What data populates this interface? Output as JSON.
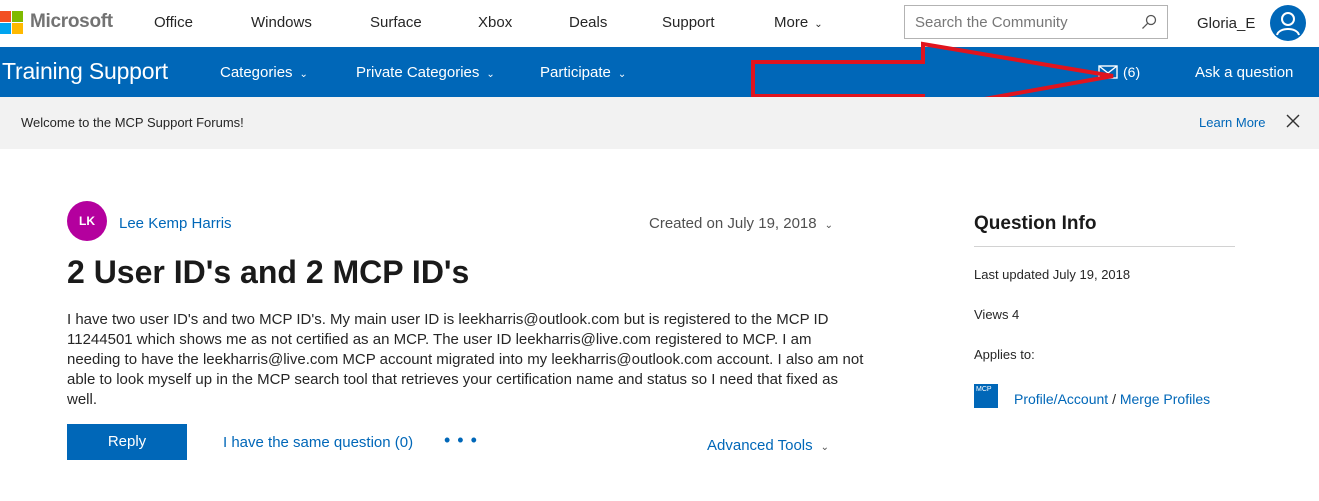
{
  "colors": {
    "brand_blue": "#0067b8",
    "banner_bg": "#f2f2f2",
    "avatar_lk": "#b4009e",
    "annotation_red": "#e0141e",
    "ms_logo": [
      "#f25022",
      "#7fba00",
      "#00a4ef",
      "#ffb900"
    ]
  },
  "topbar": {
    "logo_text": "Microsoft",
    "nav": [
      "Office",
      "Windows",
      "Surface",
      "Xbox",
      "Deals",
      "Support",
      "More"
    ],
    "search_placeholder": "Search the Community",
    "user_name": "Gloria_E"
  },
  "bluebar": {
    "brand": "Training Support",
    "nav": [
      "Categories",
      "Private Categories",
      "Participate"
    ],
    "mail_count": "(6)",
    "ask": "Ask a question"
  },
  "banner": {
    "text": "Welcome to the MCP Support Forums!",
    "learn_more": "Learn More"
  },
  "question": {
    "avatar_initials": "LK",
    "author": "Lee Kemp Harris",
    "created": "Created on July 19, 2018",
    "title": "2 User ID's and 2 MCP ID's",
    "body": "I have two user ID's and two MCP ID's. My main user ID is leekharris@outlook.com but is registered to the MCP ID 11244501 which shows me as not certified as an MCP. The user ID leekharris@live.com registered to MCP. I am needing to have the leekharris@live.com MCP account migrated into my leekharris@outlook.com account. I also am not able to look myself up in the MCP search tool that retrieves your certification name and status so I need that fixed as well.",
    "reply": "Reply",
    "same_question": "I have the same question (0)",
    "more_dots": "• • •",
    "advanced_tools": "Advanced Tools"
  },
  "sidebar": {
    "heading": "Question Info",
    "last_updated": "Last updated July 19, 2018",
    "views": "Views 4",
    "applies_to": "Applies to:",
    "badge": "MCP",
    "link1": "Profile/Account",
    "separator": "/",
    "link2": "Merge Profiles"
  }
}
